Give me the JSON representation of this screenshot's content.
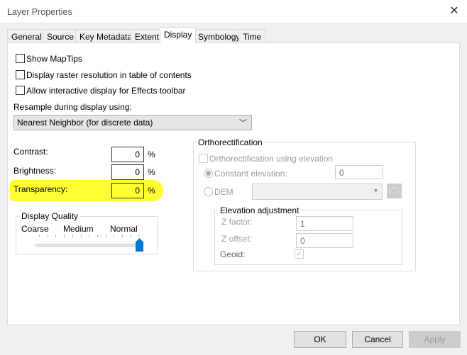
{
  "window": {
    "title": "Layer Properties",
    "close_icon": "close-icon"
  },
  "tabs": [
    {
      "label": "General"
    },
    {
      "label": "Source"
    },
    {
      "label": "Key Metadata"
    },
    {
      "label": "Extent"
    },
    {
      "label": "Display",
      "active": true
    },
    {
      "label": "Symbology"
    },
    {
      "label": "Time"
    }
  ],
  "display": {
    "checkboxes": [
      {
        "label": "Show MapTips",
        "checked": false
      },
      {
        "label": "Display raster resolution in table of contents",
        "checked": false
      },
      {
        "label": "Allow interactive display for Effects toolbar",
        "checked": false
      }
    ],
    "resample_label": "Resample during display using:",
    "resample_value": "Nearest Neighbor (for discrete data)",
    "contrast": {
      "label": "Contrast:",
      "value": "0",
      "unit": "%"
    },
    "brightness": {
      "label": "Brightness:",
      "value": "0",
      "unit": "%"
    },
    "transparency": {
      "label": "Transparency:",
      "value": "0",
      "unit": "%",
      "highlight_color": "#ffff33"
    },
    "quality": {
      "title": "Display Quality",
      "labels": [
        "Coarse",
        "Medium",
        "Normal"
      ],
      "level_percent": 100,
      "accent": "#0078d7"
    }
  },
  "ortho": {
    "title": "Orthorectification",
    "use_elevation": {
      "label": "Orthorectification using elevation",
      "checked": false
    },
    "constant": {
      "label": "Constant elevation:",
      "value": "0",
      "selected": true
    },
    "dem": {
      "label": "DEM",
      "value": ""
    },
    "elev": {
      "title": "Elevation adjustment",
      "zfactor_label": "Z factor:",
      "zfactor": "1",
      "zoffset_label": "Z offset:",
      "zoffset": "0",
      "geoid_label": "Geoid:",
      "geoid_checked": true
    }
  },
  "buttons": {
    "ok": "OK",
    "cancel": "Cancel",
    "apply": "Apply"
  }
}
